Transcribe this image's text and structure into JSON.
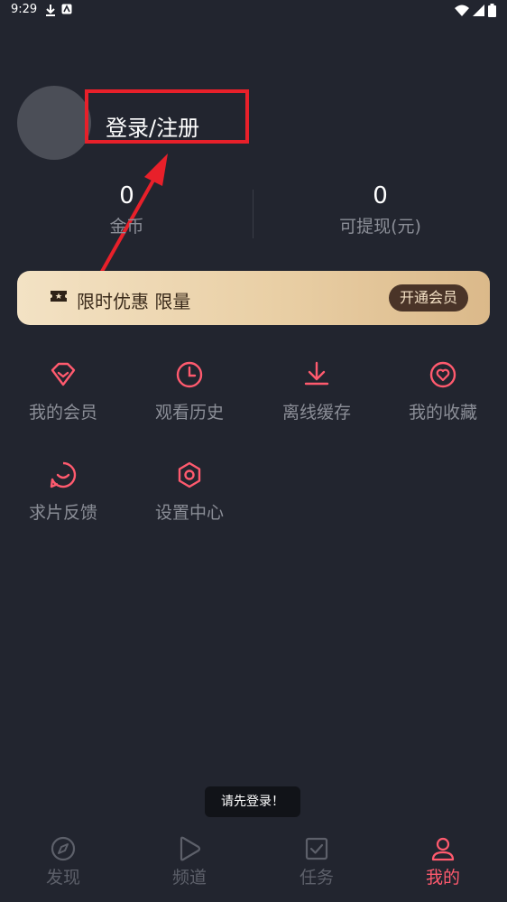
{
  "status_bar": {
    "time": "9:29"
  },
  "profile": {
    "login_label": "登录/注册"
  },
  "stats": [
    {
      "value": "0",
      "label": "金币"
    },
    {
      "value": "0",
      "label": "可提现(元)"
    }
  ],
  "vip_banner": {
    "text": "限时优惠 限量",
    "button": "开通会员"
  },
  "menu": [
    {
      "label": "我的会员",
      "icon": "diamond-icon"
    },
    {
      "label": "观看历史",
      "icon": "clock-icon"
    },
    {
      "label": "离线缓存",
      "icon": "download-icon"
    },
    {
      "label": "我的收藏",
      "icon": "heart-icon"
    },
    {
      "label": "求片反馈",
      "icon": "feedback-icon"
    },
    {
      "label": "设置中心",
      "icon": "settings-icon"
    }
  ],
  "toast": "请先登录！",
  "tabs": [
    {
      "label": "发现",
      "icon": "compass-icon",
      "active": false
    },
    {
      "label": "频道",
      "icon": "play-icon",
      "active": false
    },
    {
      "label": "任务",
      "icon": "task-icon",
      "active": false
    },
    {
      "label": "我的",
      "icon": "user-icon",
      "active": true
    }
  ],
  "colors": {
    "accent": "#ff5a6e",
    "background": "#22252f",
    "annotation": "#e8202a"
  }
}
